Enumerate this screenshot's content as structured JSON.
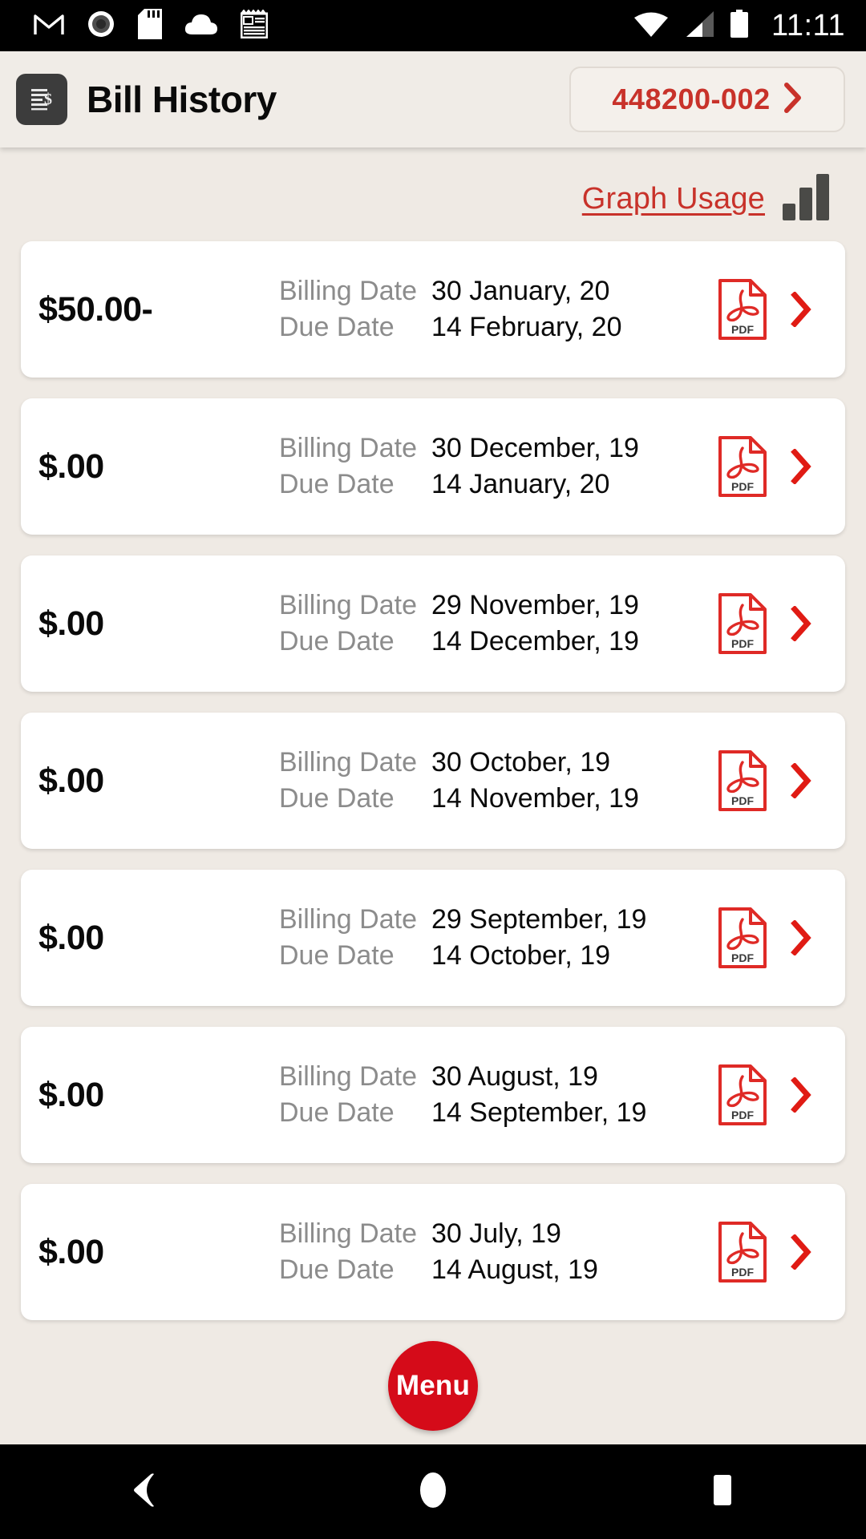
{
  "status_bar": {
    "icons": [
      "gmail-icon",
      "record-icon",
      "sd-card-icon",
      "cloud-icon",
      "news-icon"
    ],
    "wifi": "wifi-icon",
    "signal": "cellular-signal-icon",
    "battery": "battery-icon",
    "time": "11:11"
  },
  "header": {
    "icon": "bill-document-icon",
    "title": "Bill History",
    "account": {
      "number": "448200-002",
      "chevron": "chevron-right-icon"
    }
  },
  "toolbar": {
    "graph_usage_label": "Graph Usage",
    "graph_usage_icon": "bar-chart-icon"
  },
  "labels": {
    "billing_date": "Billing Date",
    "due_date": "Due Date",
    "pdf_icon": "pdf-file-icon",
    "chevron_icon": "chevron-right-icon"
  },
  "bills": [
    {
      "amount": "$50.00-",
      "billing_date": "30 January, 20",
      "due_date": "14 February, 20"
    },
    {
      "amount": "$.00",
      "billing_date": "30 December, 19",
      "due_date": "14 January, 20"
    },
    {
      "amount": "$.00",
      "billing_date": "29 November, 19",
      "due_date": "14 December, 19"
    },
    {
      "amount": "$.00",
      "billing_date": "30 October, 19",
      "due_date": "14 November, 19"
    },
    {
      "amount": "$.00",
      "billing_date": "29 September, 19",
      "due_date": "14 October, 19"
    },
    {
      "amount": "$.00",
      "billing_date": "30 August, 19",
      "due_date": "14 September, 19"
    },
    {
      "amount": "$.00",
      "billing_date": "30 July, 19",
      "due_date": "14 August, 19"
    }
  ],
  "fab": {
    "label": "Menu"
  },
  "nav_bar": {
    "back": "back-triangle-icon",
    "home": "home-circle-icon",
    "recents": "recents-square-icon"
  },
  "colors": {
    "accent_red": "#C8322A",
    "fab_red": "#D50B19",
    "background": "#EFEAE4",
    "card": "#FFFFFF",
    "label_gray": "#8C8C8C",
    "icon_dark": "#3C3C3C"
  }
}
